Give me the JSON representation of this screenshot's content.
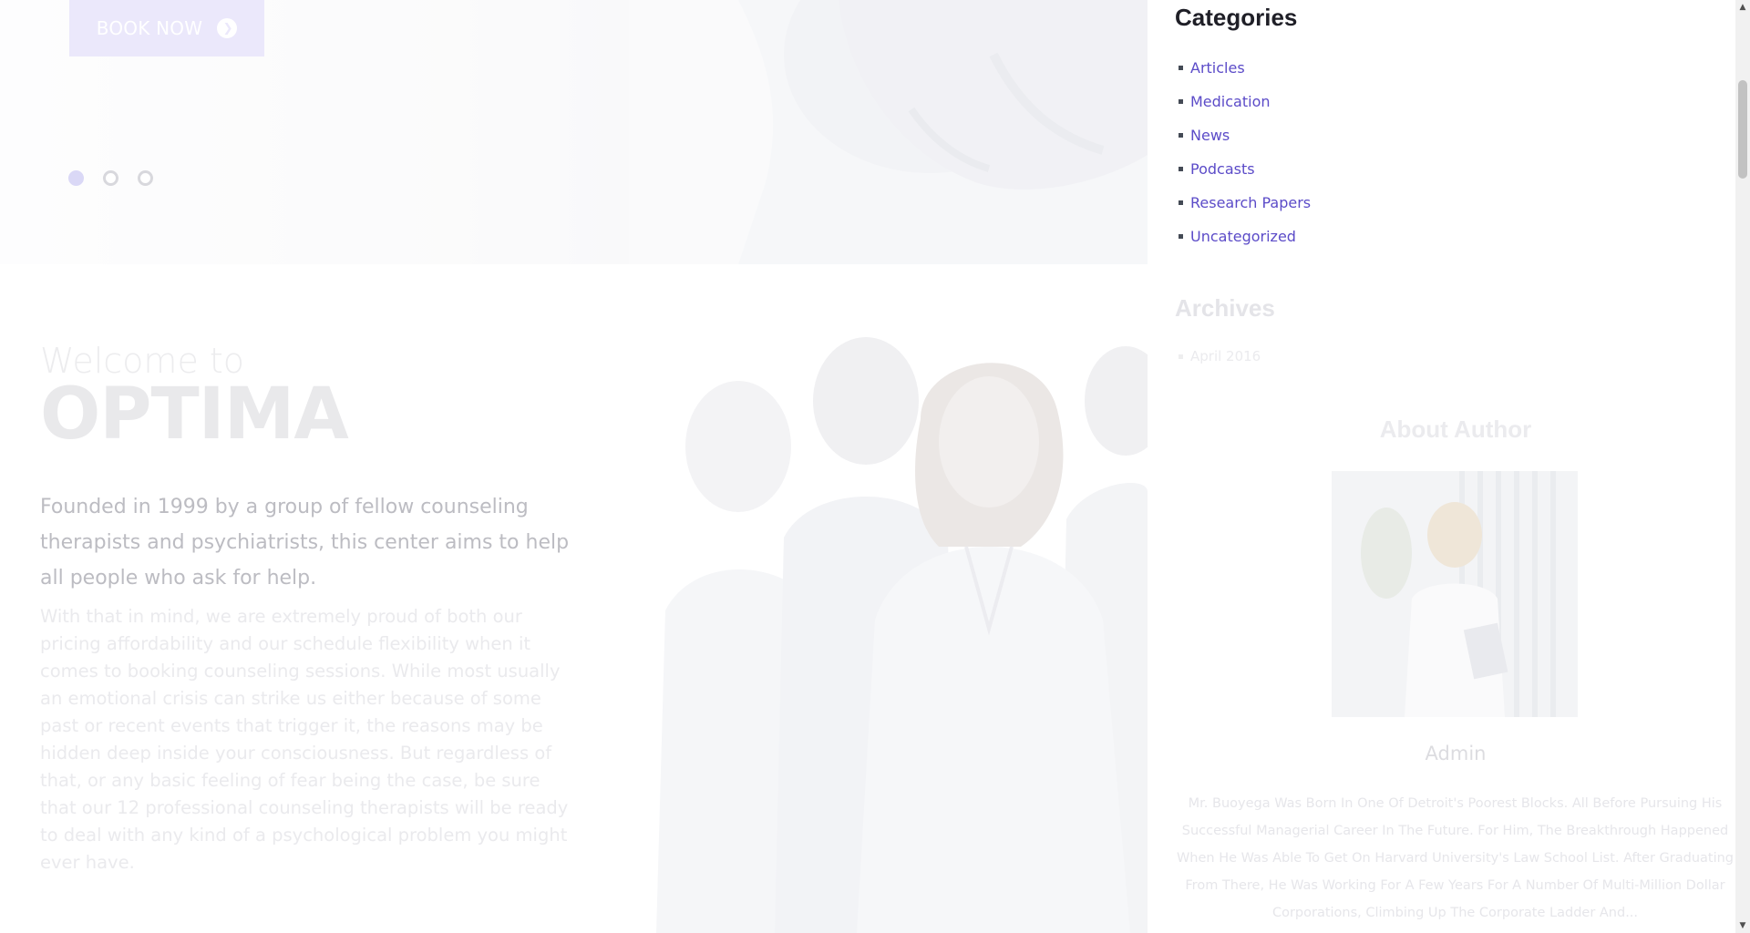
{
  "hero": {
    "book_button_label": "BOOK NOW",
    "slides": [
      "slide-1",
      "slide-2",
      "slide-3"
    ],
    "active_slide": 1
  },
  "welcome": {
    "pre_title": "Welcome to",
    "title": "OPTIMA",
    "lead": "Founded in 1999 by a group of fellow counseling therapists and psychiatrists, this center aims to help all people who ask for help.",
    "body": "With that in mind, we are extremely proud of both our pricing affordability and our schedule flexibility when it comes to booking counseling sessions. While most usually an emotional crisis can strike us either because of some past or recent events that trigger it, the reasons may be hidden deep inside your consciousness. But regardless of that, or any basic feeling of fear being the case, be sure that our 12 professional counseling therapists will be ready to deal with any kind of a psychological problem you might ever have."
  },
  "sidebar": {
    "categories": {
      "title": "Categories",
      "items": [
        "Articles",
        "Medication",
        "News",
        "Podcasts",
        "Research Papers",
        "Uncategorized"
      ]
    },
    "archives": {
      "title": "Archives",
      "items": [
        "April 2016"
      ]
    },
    "about_author": {
      "title": "About Author",
      "name": "Admin",
      "bio": "Mr. Buoyega Was Born In One Of Detroit's Poorest Blocks. All Before Pursuing His Successful Managerial Career In The Future. For Him, The Breakthrough Happened When He Was Able To Get On Harvard University's Law School List. After Graduating From There, He Was Working For A Few Years For A Number Of Multi-Million Dollar Corporations, Climbing Up The Corporate Ladder And..."
    }
  },
  "colors": {
    "accent": "#5b4bc8",
    "heading": "#1f1f27",
    "button_bg": "#ebe8fb"
  },
  "icons": {
    "book_button": "arrow-right-circle-icon",
    "category_bullet": "square-bullet-icon",
    "scroll_up": "triangle-up-icon",
    "scroll_down": "triangle-down-icon"
  }
}
